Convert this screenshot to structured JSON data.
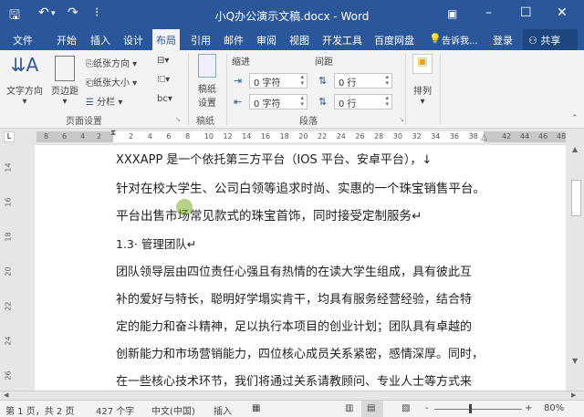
{
  "window": {
    "title": "小Q办公演示文稿.docx - Word"
  },
  "quick_access": {
    "save": "🖫",
    "undo": "↶",
    "undo_drop": "▾",
    "redo": "↷",
    "customize": "⁝"
  },
  "window_controls": {
    "ribbon_display": "▣",
    "minimize": "–",
    "maximize": "☐",
    "close": "✕"
  },
  "tabs": [
    {
      "label": "文件"
    },
    {
      "label": "开始"
    },
    {
      "label": "插入"
    },
    {
      "label": "设计"
    },
    {
      "label": "布局"
    },
    {
      "label": "引用"
    },
    {
      "label": "邮件"
    },
    {
      "label": "审阅"
    },
    {
      "label": "视图"
    },
    {
      "label": "开发工具"
    },
    {
      "label": "百度网盘"
    }
  ],
  "tell_me": "告诉我...",
  "login": "登录",
  "share": "共享",
  "ribbon": {
    "page_setup": {
      "text_direction": "文字方向",
      "margins": "页边距",
      "orientation": "纸张方向",
      "size": "纸张大小",
      "columns": "分栏",
      "group": "页面设置"
    },
    "manuscript": {
      "button_line1": "稿纸",
      "button_line2": "设置",
      "group": "稿纸"
    },
    "paragraph": {
      "indent_label": "缩进",
      "spacing_label": "间距",
      "indent_left": "0 字符",
      "indent_right": "0 字符",
      "spacing_before": "0 行",
      "spacing_after": "0 行",
      "group": "段落"
    },
    "arrange": {
      "label": "排列"
    }
  },
  "ruler": {
    "corner": "L",
    "left_ticks": [
      "8",
      "6",
      "4",
      "2"
    ],
    "ticks": [
      "2",
      "4",
      "6",
      "8",
      "10",
      "12",
      "14",
      "16",
      "18",
      "20",
      "22",
      "24",
      "26",
      "28",
      "30",
      "32",
      "34",
      "36",
      "38"
    ],
    "right_ticks": [
      "42",
      "44",
      "46",
      "48"
    ],
    "vertical": [
      "14",
      "16",
      "18",
      "20",
      "22",
      "24",
      "26",
      "28"
    ]
  },
  "document": {
    "lines": [
      "XXXAPP 是一个依托第三方平台（IOS 平台、安卓平台），↓",
      "针对在校大学生、公司白领等追求时尚、实惠的一个珠宝销售平台。",
      "平台出售市场常见款式的珠宝首饰，同时接受定制服务↵",
      "1.3· 管理团队↵",
      "团队领导层由四位责任心强且有热情的在读大学生组成，具有彼此互",
      "补的爱好与特长，聪明好学塌实肯干，均具有服务经营经验，结合特",
      "定的能力和奋斗精神，足以执行本项目的创业计划；团队具有卓越的",
      "创新能力和市场营销能力，四位核心成员关系紧密，感情深厚。同时，",
      "在一些核心技术环节，我们将通过关系请教顾问、专业人士等方式来"
    ]
  },
  "status": {
    "page": "第 1 页，共 2 页",
    "words": "427 个字",
    "language": "中文(中国)",
    "mode": "插入",
    "zoom_minus": "-",
    "zoom_plus": "+",
    "zoom": "80%"
  },
  "zoom_level_percent": 80,
  "colors": {
    "accent": "#2b579a"
  }
}
